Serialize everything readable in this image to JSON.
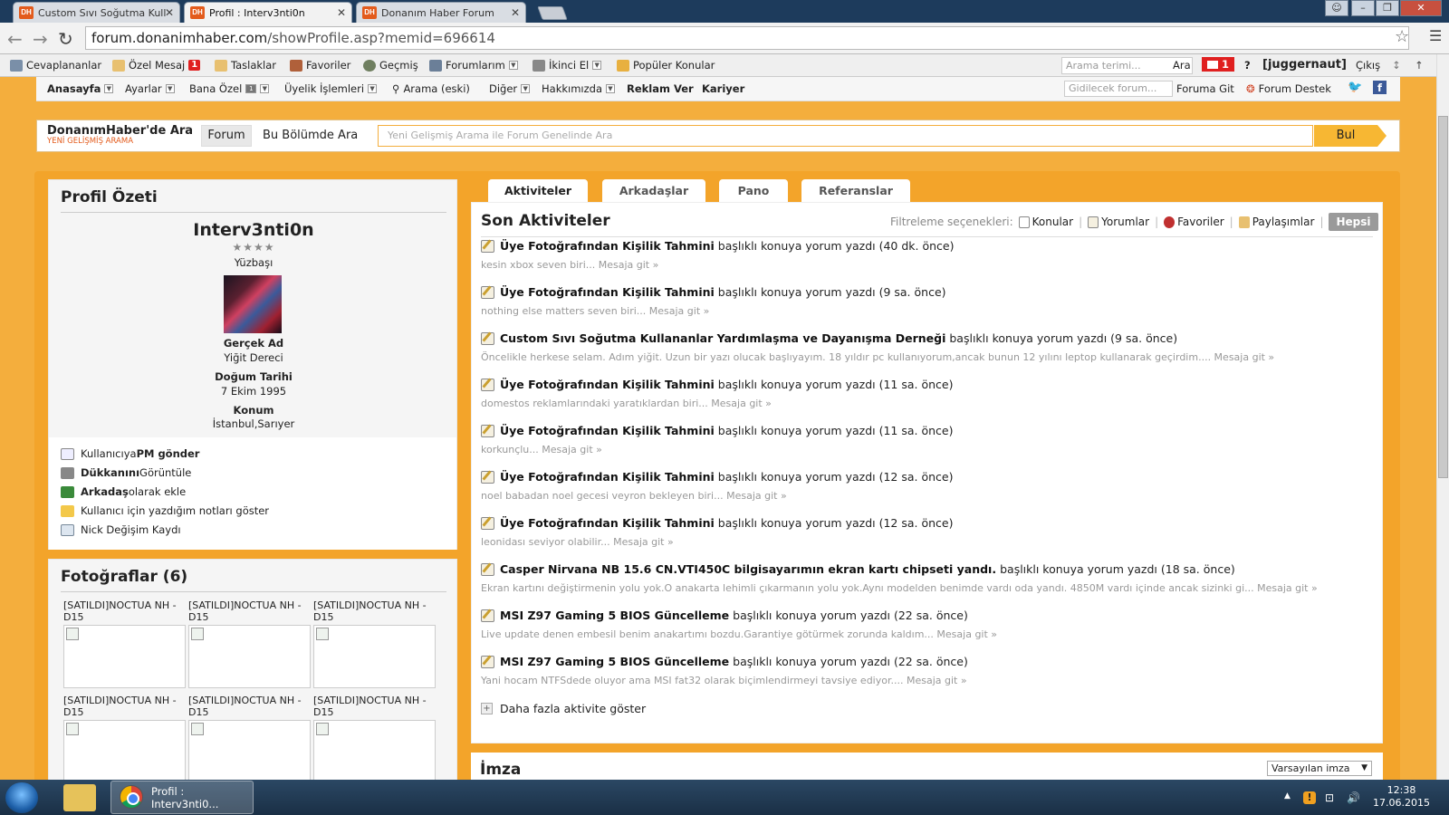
{
  "browser": {
    "tabs": [
      {
        "label": "Custom Sıvı Soğutma Kull"
      },
      {
        "label": "Profil : Interv3nti0n"
      },
      {
        "label": "Donanım Haber Forum"
      }
    ],
    "favicon_text": "DH",
    "url_host": "forum.donanimhaber.com",
    "url_path": "/showProfile.asp?memid=696614"
  },
  "toolbar": {
    "items": [
      "Cevaplananlar",
      "Özel Mesaj",
      "Taslaklar",
      "Favoriler",
      "Geçmiş",
      "Forumlarım",
      "İkinci El",
      "Popüler Konular"
    ],
    "pm_count": "1",
    "search_placeholder": "Arama terimi...",
    "search_button": "Ara",
    "notif_count": "1",
    "help": "?",
    "username": "[juggernaut]",
    "logout": "Çıkış"
  },
  "navbar": {
    "items": [
      "Anasayfa",
      "Ayarlar",
      "Bana Özel",
      "Üyelik İşlemleri",
      "Arama (eski)",
      "Diğer",
      "Hakkımızda",
      "Reklam Ver",
      "Kariyer"
    ],
    "bana_ozel_count": "1",
    "goto_placeholder": "Gidilecek forum...",
    "goto_button": "Foruma Git",
    "support": "Forum Destek"
  },
  "searchpanel": {
    "brand": "DonanımHaber'de Ara",
    "brand_sub": "YENİ GELİŞMİŞ ARAMA",
    "forum_button": "Forum",
    "section_search": "Bu Bölümde Ara",
    "placeholder": "Yeni Gelişmiş Arama ile Forum Genelinde Ara",
    "button": "Bul"
  },
  "profile": {
    "title": "Profil Özeti",
    "username": "Interv3nti0n",
    "stars": "★★★★",
    "rank": "Yüzbaşı",
    "real_name_label": "Gerçek Ad",
    "real_name": "Yiğit Dereci",
    "birth_label": "Doğum Tarihi",
    "birth": "7 Ekim 1995",
    "location_label": "Konum",
    "location": "İstanbul,Sarıyer",
    "links": {
      "pm_pre": "Kullanıcıya ",
      "pm_bold": "PM gönder",
      "shop_bold": "Dükkanını",
      "shop_post": " Görüntüle",
      "friend_bold": "Arkadaş",
      "friend_post": " olarak ekle",
      "notes": "Kullanıcı için yazdığım notları göster",
      "nick": "Nick Değişim Kaydı"
    }
  },
  "photos": {
    "title": "Fotoğraflar (6)",
    "items": [
      "[SATILDI]NOCTUA NH - D15",
      "[SATILDI]NOCTUA NH - D15",
      "[SATILDI]NOCTUA NH - D15",
      "[SATILDI]NOCTUA NH - D15",
      "[SATILDI]NOCTUA NH - D15",
      "[SATILDI]NOCTUA NH - D15"
    ]
  },
  "tabs": [
    "Aktiviteler",
    "Arkadaşlar",
    "Pano",
    "Referanslar"
  ],
  "activities": {
    "title": "Son Aktiviteler",
    "filter_label": "Filtreleme seçenekleri:",
    "filters": [
      "Konular",
      "Yorumlar",
      "Favoriler",
      "Paylaşımlar"
    ],
    "filter_all": "Hepsi",
    "items": [
      {
        "title": "Üye Fotoğrafından Kişilik Tahmini",
        "action": "başlıklı konuya yorum yazdı (40 dk. önce)",
        "excerpt": "kesin xbox seven biri... Mesaja git »"
      },
      {
        "title": "Üye Fotoğrafından Kişilik Tahmini",
        "action": "başlıklı konuya yorum yazdı (9 sa. önce)",
        "excerpt": "nothing else matters seven biri... Mesaja git »"
      },
      {
        "title": "Custom Sıvı Soğutma Kullananlar Yardımlaşma ve Dayanışma Derneği",
        "action": "başlıklı konuya yorum yazdı (9 sa. önce)",
        "excerpt": "Öncelikle herkese selam. Adım yiğit. Uzun bir yazı olucak başlıyayım. 18 yıldır pc kullanıyorum,ancak bunun 12 yılını leptop kullanarak geçirdim.... Mesaja git »"
      },
      {
        "title": "Üye Fotoğrafından Kişilik Tahmini",
        "action": "başlıklı konuya yorum yazdı (11 sa. önce)",
        "excerpt": "domestos reklamlarındaki yaratıklardan biri... Mesaja git »"
      },
      {
        "title": "Üye Fotoğrafından Kişilik Tahmini",
        "action": "başlıklı konuya yorum yazdı (11 sa. önce)",
        "excerpt": "korkunçlu... Mesaja git »"
      },
      {
        "title": "Üye Fotoğrafından Kişilik Tahmini",
        "action": "başlıklı konuya yorum yazdı (12 sa. önce)",
        "excerpt": "noel babadan noel gecesi veyron bekleyen biri... Mesaja git »"
      },
      {
        "title": "Üye Fotoğrafından Kişilik Tahmini",
        "action": "başlıklı konuya yorum yazdı (12 sa. önce)",
        "excerpt": "leonidası seviyor olabilir... Mesaja git »"
      },
      {
        "title": "Casper Nirvana NB 15.6 CN.VTI450C bilgisayarımın ekran kartı chipseti yandı.",
        "action": "başlıklı konuya yorum yazdı (18 sa. önce)",
        "excerpt": "Ekran kartını değiştirmenin yolu yok.O anakarta lehimli çıkarmanın yolu yok.Aynı modelden benimde vardı oda yandı. 4850M vardı içinde ancak sizinki gi... Mesaja git »"
      },
      {
        "title": "MSI Z97 Gaming 5 BIOS Güncelleme",
        "action": "başlıklı konuya yorum yazdı (22 sa. önce)",
        "excerpt": "Live update denen embesil benim anakartımı bozdu.Garantiye götürmek zorunda kaldım... Mesaja git »"
      },
      {
        "title": "MSI Z97 Gaming 5 BIOS Güncelleme",
        "action": "başlıklı konuya yorum yazdı (22 sa. önce)",
        "excerpt": "Yani hocam NTFSdede oluyor ama MSI fat32 olarak biçimlendirmeyi tavsiye ediyor.... Mesaja git »"
      }
    ],
    "more": "Daha fazla aktivite göster"
  },
  "signature": {
    "title": "İmza",
    "select": "Varsayılan imza"
  },
  "taskbar": {
    "chrome_label": "Profil : Interv3nti0...",
    "time": "12:38",
    "date": "17.06.2015"
  }
}
